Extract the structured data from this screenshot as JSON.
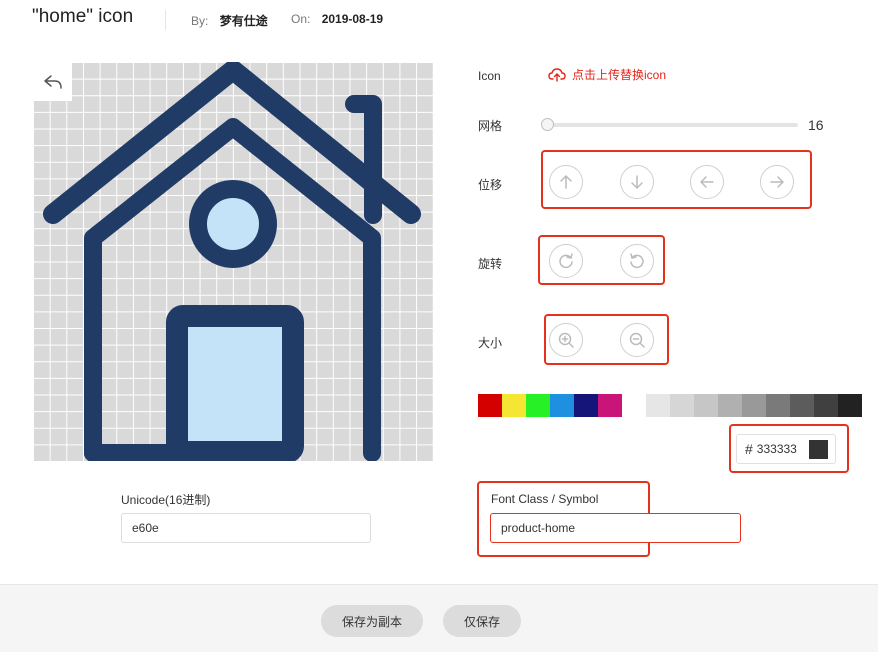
{
  "header": {
    "title": "\"home\"  icon",
    "by_label": "By:",
    "author": "梦有仕途",
    "on_label": "On:",
    "date": "2019-08-19"
  },
  "canvas": {
    "icon_fill_color": "#213b67",
    "icon_accent_color": "#c5e3f8",
    "grid_size": 16
  },
  "panel": {
    "icon_label": "Icon",
    "upload_label": "点击上传替换icon",
    "grid_label": "网格",
    "grid_value": "16",
    "move_label": "位移",
    "rotate_label": "旋转",
    "size_label": "大小"
  },
  "palette": {
    "colors": [
      "#d40000",
      "#f5e633",
      "#27f027",
      "#1f8fe0",
      "#141479",
      "#c9157a",
      "#ffffff",
      "#e6e6e6",
      "#d6d6d6",
      "#c6c6c6",
      "#b0b0b0",
      "#999999",
      "#7a7a7a",
      "#5c5c5c",
      "#404040",
      "#222222"
    ],
    "hash": "#",
    "hex_value": "333333",
    "selected_color": "#333333"
  },
  "unicode": {
    "label": "Unicode(16进制)",
    "value": "e60e"
  },
  "font_class": {
    "label": "Font Class / Symbol",
    "value": "product-home"
  },
  "footer": {
    "save_copy_label": "保存为副本",
    "save_only_label": "仅保存"
  }
}
